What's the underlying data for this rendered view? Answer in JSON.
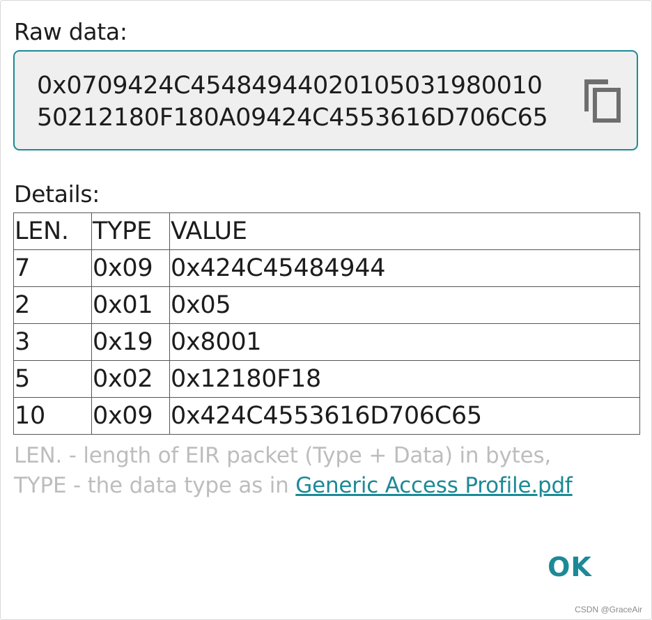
{
  "dialog": {
    "raw_label": "Raw data:",
    "raw_value_line1": "0x0709424C45484944020105031980010",
    "raw_value_line2": "50212180F180A09424C4553616D706C65",
    "details_label": "Details:",
    "table": {
      "headers": [
        "LEN.",
        "TYPE",
        "VALUE"
      ],
      "rows": [
        [
          "7",
          "0x09",
          "0x424C45484944"
        ],
        [
          "2",
          "0x01",
          "0x05"
        ],
        [
          "3",
          "0x19",
          "0x8001"
        ],
        [
          "5",
          "0x02",
          "0x12180F18"
        ],
        [
          "10",
          "0x09",
          "0x424C4553616D706C65"
        ]
      ]
    },
    "footnote_line1": "LEN. - length of EIR packet (Type + Data) in bytes,",
    "footnote_line2_prefix": "TYPE - the data type as in ",
    "footnote_link": "Generic Access Profile.pdf",
    "ok_label": "OK",
    "copy_icon": "copy-icon"
  },
  "colors": {
    "accent": "#1b8a96",
    "raw_box_bg": "#efefef",
    "footnote_text": "#bdbdbd",
    "text": "#1c1c1c"
  },
  "watermark": "CSDN @GraceAir"
}
